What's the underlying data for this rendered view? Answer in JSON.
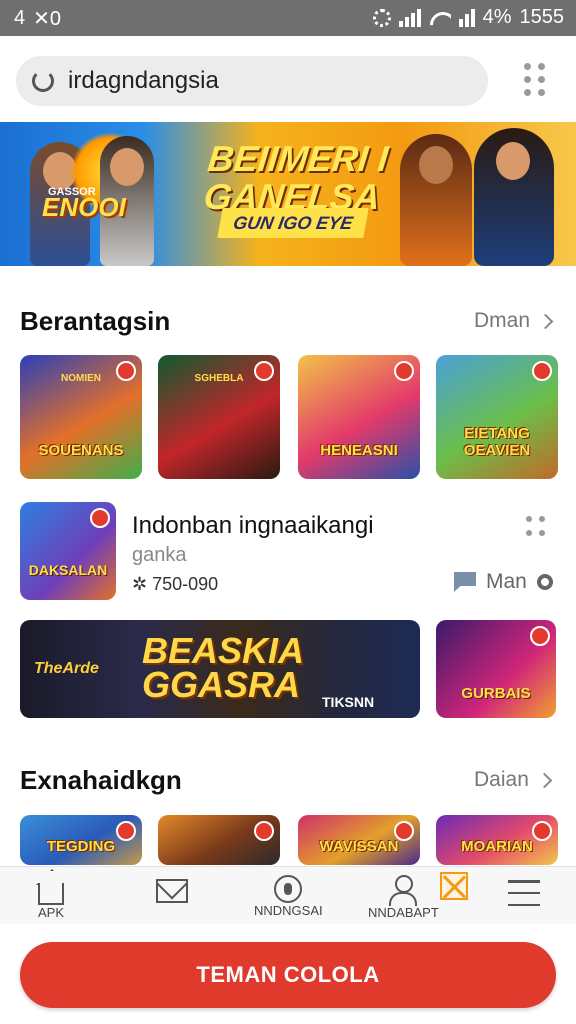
{
  "status_bar": {
    "left_text": "4",
    "left_icon_text": "✕0",
    "battery_text": "4%",
    "time": "1555"
  },
  "search": {
    "value": "irdagndangsia"
  },
  "hero": {
    "title_line1": "BEIIMERI I",
    "title_line2": "GANELSA",
    "ribbon": "GUN IGO EYE",
    "logo_small": "GASSOR",
    "logo": "ENOOI"
  },
  "section1": {
    "title": "Berantagsin",
    "more": "Dman",
    "tiles": [
      {
        "top_caption": "NOMIEN",
        "caption": "SOUENANS",
        "colors": [
          "#2a3fb8",
          "#e3702a",
          "#3fae4a"
        ]
      },
      {
        "top_caption": "SGHEBLA",
        "caption": "",
        "colors": [
          "#0f5a2f",
          "#c1262a",
          "#2a1a12"
        ]
      },
      {
        "top_caption": "",
        "caption": "HENEASNI",
        "colors": [
          "#f3c248",
          "#e33a6a",
          "#2a4fa8"
        ]
      },
      {
        "top_caption": "",
        "caption": "EIETANG OEAVIEN",
        "colors": [
          "#4aa0d8",
          "#6abf4a",
          "#c06a2a"
        ]
      }
    ]
  },
  "app": {
    "title": "Indonban ingnaaikangi",
    "subtitle": "ganka",
    "meta": "✲ 750-090",
    "action": "Man",
    "icon_caption": "DAKSALAN"
  },
  "wide_banner": {
    "left": "TheArde",
    "title_line1": "BEASKIA",
    "title_line2": "GGASRA",
    "right": "TIKSNN",
    "side_caption": "GURBAIS"
  },
  "section2": {
    "title": "Exnahaidkgn",
    "more": "Daian",
    "tiles": [
      {
        "caption": "TEGDING",
        "colors": [
          "#3a8fd8",
          "#2a5ab8",
          "#c79a4a"
        ]
      },
      {
        "caption": "",
        "colors": [
          "#e38a2a",
          "#7a3a1a",
          "#2a2a2a"
        ]
      },
      {
        "caption": "WAVISSAN",
        "colors": [
          "#d0306a",
          "#e3a02a",
          "#4a2a8a"
        ]
      },
      {
        "caption": "MOARIAN",
        "colors": [
          "#6a2ab8",
          "#e34a6a",
          "#f2c84a"
        ]
      }
    ]
  },
  "bottom_nav": {
    "items": [
      {
        "label": "APK",
        "icon": "home-icon"
      },
      {
        "label": "",
        "icon": "mail-icon"
      },
      {
        "label": "NNDNGSAI",
        "icon": "circle-icon"
      },
      {
        "label": "NNDABAPT",
        "icon": "person-icon"
      },
      {
        "label": "",
        "icon": "close-box-icon"
      },
      {
        "label": "",
        "icon": "menu-icon"
      }
    ]
  },
  "cta": {
    "label": "TEMAN COLOLA"
  }
}
